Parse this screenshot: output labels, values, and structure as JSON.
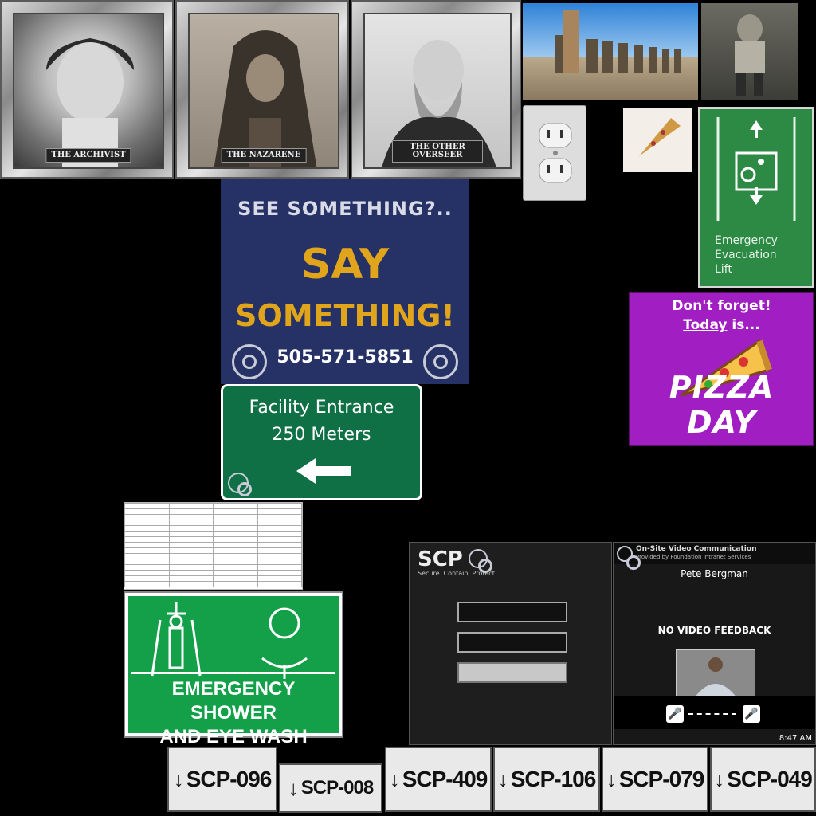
{
  "portraits": [
    {
      "plaque": "THE ARCHIVIST"
    },
    {
      "plaque": "THE NAZARENE"
    },
    {
      "plaque": "THE OTHER OVERSEER"
    }
  ],
  "poster": {
    "line1": "SEE SOMETHING?..",
    "line2": "SAY",
    "line3": "SOMETHING!",
    "phone": "505-571-5851"
  },
  "highway_sign": {
    "line1": "Facility Entrance",
    "line2": "250 Meters",
    "arrow": "←"
  },
  "pizza_poster": {
    "line1": "Don't forget!",
    "line2_underlined": "Today",
    "line2_rest": " is...",
    "line3": "PIZZA DAY"
  },
  "evac_sign": {
    "line1": "Emergency",
    "line2": "Evacuation",
    "line3": "Lift"
  },
  "shower_sign": {
    "line1": "EMERGENCY SHOWER",
    "line2": "AND EYE WASH"
  },
  "login_screen": {
    "brand": "SCP",
    "tagline": "Secure. Contain. Protect"
  },
  "video_screen": {
    "header_title": "On-Site Video Communication",
    "header_sub": "Provided by Foundation Intranet Services",
    "caller": "Pete Bergman",
    "status": "NO VIDEO FEEDBACK",
    "time": "8:47 AM"
  },
  "scp_tags": [
    {
      "label": "SCP-096"
    },
    {
      "label": "SCP-008"
    },
    {
      "label": "SCP-409"
    },
    {
      "label": "SCP-106"
    },
    {
      "label": "SCP-079"
    },
    {
      "label": "SCP-049"
    }
  ]
}
